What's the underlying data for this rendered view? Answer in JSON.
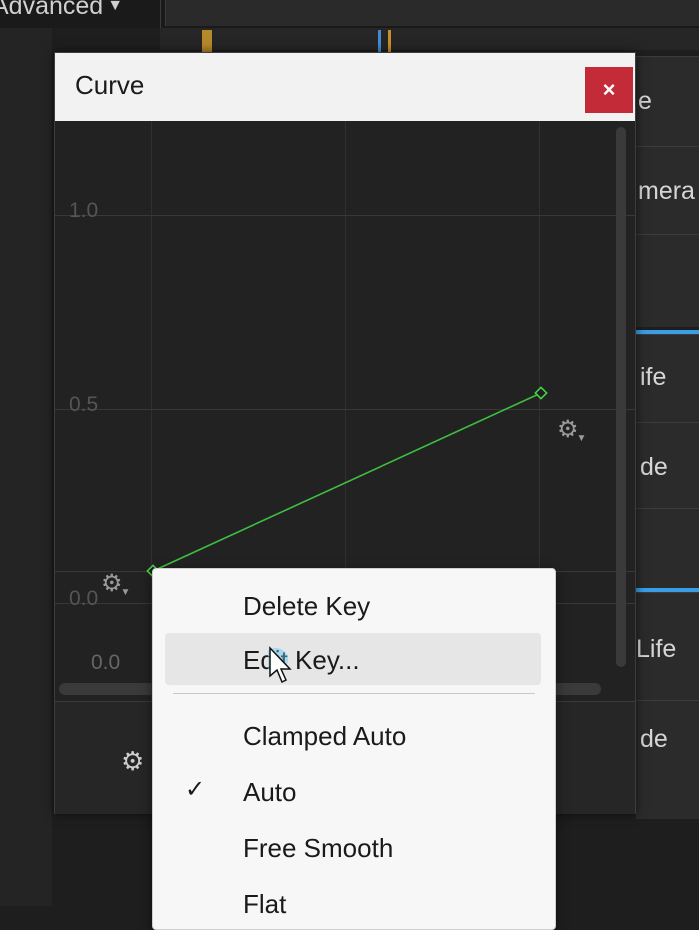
{
  "toolbar": {
    "advanced_label": "Advanced"
  },
  "right_panel": {
    "items": [
      "e",
      "mera",
      "ife",
      "de",
      "Life",
      "de"
    ]
  },
  "curve_window": {
    "title": "Curve",
    "close_glyph": "×",
    "y_labels": [
      "1.0",
      "0.5",
      "0.0",
      "0.0"
    ],
    "keys": [
      {
        "x": 0.0,
        "y": 0.0
      },
      {
        "x": 1.0,
        "y": 0.5
      }
    ],
    "curve_color": "#3fbf3f"
  },
  "context_menu": {
    "items": [
      {
        "label": "Delete Key",
        "checked": false,
        "highlighted": false
      },
      {
        "label": "Edit Key...",
        "checked": false,
        "highlighted": true
      },
      {
        "label": "Clamped Auto",
        "checked": false,
        "highlighted": false
      },
      {
        "label": "Auto",
        "checked": true,
        "highlighted": false
      },
      {
        "label": "Free Smooth",
        "checked": false,
        "highlighted": false
      },
      {
        "label": "Flat",
        "checked": false,
        "highlighted": false
      }
    ],
    "check_glyph": "✓"
  },
  "icons": {
    "gear": "gear-icon",
    "close": "close-icon",
    "check": "check-icon",
    "dropdown": "caret-down-icon",
    "cursor": "mouse-pointer-icon"
  }
}
